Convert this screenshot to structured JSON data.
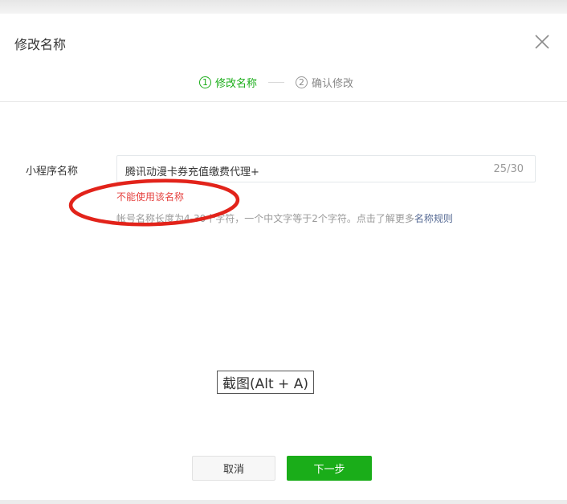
{
  "dialog": {
    "title": "修改名称",
    "close_icon": "close-icon"
  },
  "steps": [
    {
      "number": "1",
      "label": "修改名称",
      "state": "active"
    },
    {
      "number": "2",
      "label": "确认修改",
      "state": "inactive"
    }
  ],
  "form": {
    "label": "小程序名称",
    "value": "腾讯动漫卡券充值缴费代理+",
    "counter": "25/30",
    "error": "不能使用该名称",
    "hint_text": "帐号名称长度为4-30个字符，一个中文字等于2个字符。点击了解更多",
    "hint_link": "名称规则"
  },
  "overlay": {
    "screenshot_tip": "截图(Alt + A)"
  },
  "buttons": {
    "cancel": "取消",
    "next": "下一步"
  },
  "colors": {
    "accent": "#1aad19",
    "error": "#e64340",
    "link": "#576b95",
    "annotation": "#e2231a"
  }
}
